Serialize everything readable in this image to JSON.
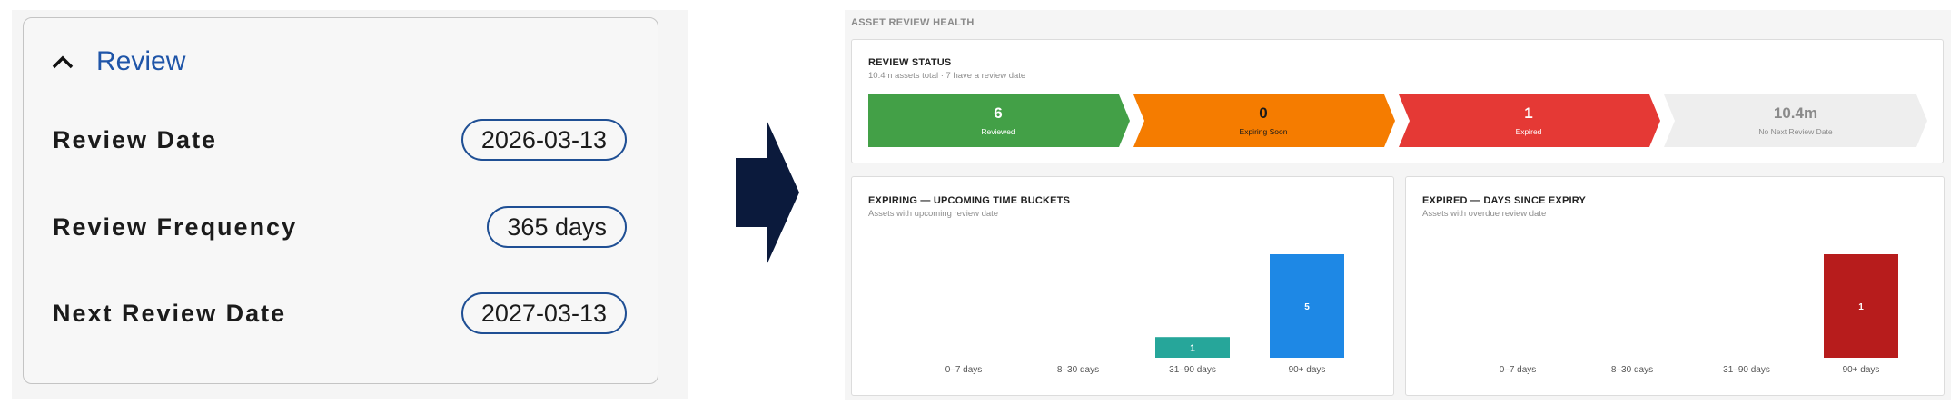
{
  "review_panel": {
    "title": "Review",
    "fields": [
      {
        "label": "Review Date",
        "value": "2026-03-13"
      },
      {
        "label": "Review Frequency",
        "value": "365 days"
      },
      {
        "label": "Next Review Date",
        "value": "2027-03-13"
      }
    ]
  },
  "dashboard": {
    "title": "ASSET REVIEW HEALTH",
    "review_status": {
      "title": "REVIEW STATUS",
      "subtitle": "10.4m assets total · 7 have a review date",
      "segments": [
        {
          "value": "6",
          "label": "Reviewed",
          "color": "#43a047",
          "text_color": "#ffffff"
        },
        {
          "value": "0",
          "label": "Expiring Soon",
          "color": "#f57c00",
          "text_color": "#1b1b1b"
        },
        {
          "value": "1",
          "label": "Expired",
          "color": "#e53935",
          "text_color": "#ffffff"
        },
        {
          "value": "10.4m",
          "label": "No Next Review Date",
          "color": "#eeeeee",
          "text_color": "#8a8a8a"
        }
      ]
    },
    "charts": [
      {
        "title": "EXPIRING — UPCOMING TIME BUCKETS",
        "subtitle": "Assets with upcoming review date"
      },
      {
        "title": "EXPIRED — DAYS SINCE EXPIRY",
        "subtitle": "Assets with overdue review date"
      }
    ]
  },
  "colors": {
    "accent_blue": "#1f55a8",
    "arrow": "#0b1a3c"
  },
  "chart_data": [
    {
      "type": "bar",
      "categories": [
        "0–7 days",
        "8–30 days",
        "31–90 days",
        "90+ days"
      ],
      "values": [
        0,
        0,
        1,
        5
      ],
      "bar_colors": [
        "#26a69a",
        "#26a69a",
        "#26a69a",
        "#1e88e5"
      ],
      "title": "EXPIRING — UPCOMING TIME BUCKETS",
      "ylim": [
        0,
        5
      ]
    },
    {
      "type": "bar",
      "categories": [
        "0–7 days",
        "8–30 days",
        "31–90 days",
        "90+ days"
      ],
      "values": [
        0,
        0,
        0,
        1
      ],
      "bar_colors": [
        "#b71c1c",
        "#b71c1c",
        "#b71c1c",
        "#b71c1c"
      ],
      "title": "EXPIRED — DAYS SINCE EXPIRY",
      "ylim": [
        0,
        1
      ]
    }
  ]
}
